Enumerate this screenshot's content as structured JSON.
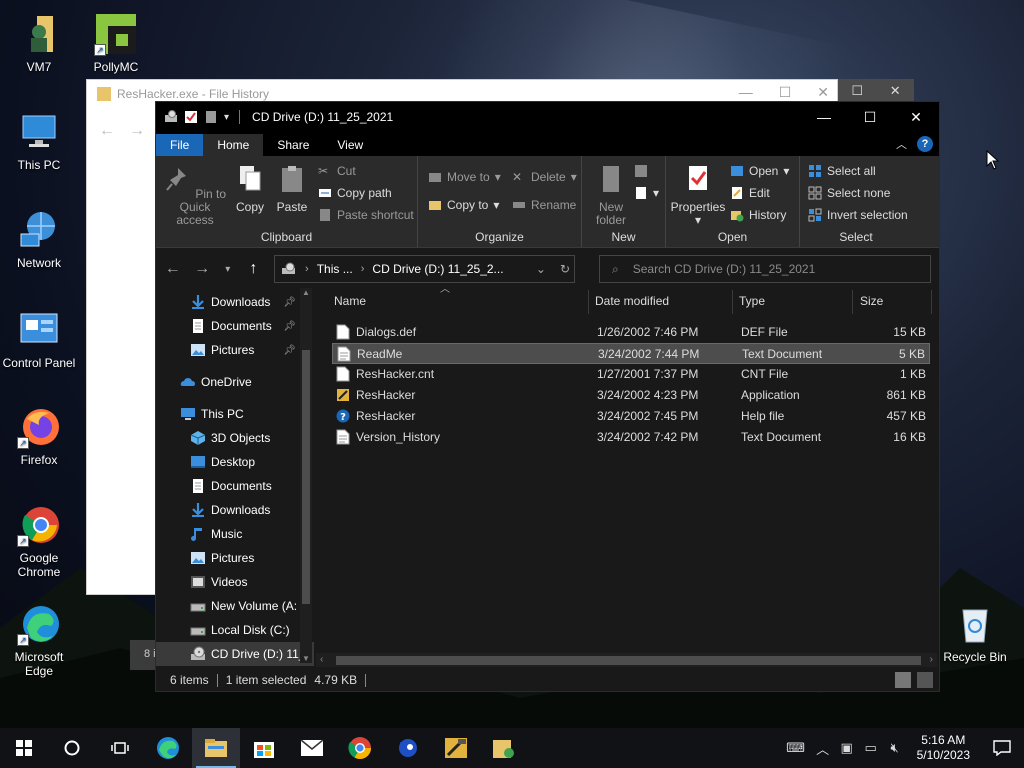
{
  "desktop": {
    "icons": [
      {
        "label": "VM7",
        "icon": "folder-user-icon"
      },
      {
        "label": "PollyMC",
        "icon": "pollymc-icon"
      },
      {
        "label": "This PC",
        "icon": "this-pc-icon"
      },
      {
        "label": "Network",
        "icon": "network-icon"
      },
      {
        "label": "Control Panel",
        "icon": "control-panel-icon"
      },
      {
        "label": "Firefox",
        "icon": "firefox-icon"
      },
      {
        "label": "Google Chrome",
        "icon": "chrome-icon"
      },
      {
        "label": "Microsoft Edge",
        "icon": "edge-icon"
      },
      {
        "label": "Recycle Bin",
        "icon": "recycle-bin-icon"
      }
    ]
  },
  "background_window": {
    "title": "ResHacker.exe - File History",
    "bottom_text": "8 i"
  },
  "explorer": {
    "title": "CD Drive (D:) 11_25_2021",
    "tabs": [
      "File",
      "Home",
      "Share",
      "View"
    ],
    "active_tab": "Home",
    "ribbon": {
      "clipboard": {
        "label": "Clipboard",
        "pin": "Pin to Quick access",
        "copy": "Copy",
        "paste": "Paste",
        "cut": "Cut",
        "copy_path": "Copy path",
        "paste_shortcut": "Paste shortcut"
      },
      "organize": {
        "label": "Organize",
        "move_to": "Move to",
        "copy_to": "Copy to",
        "delete": "Delete",
        "rename": "Rename"
      },
      "new": {
        "label": "New",
        "new_folder": "New folder"
      },
      "open": {
        "label": "Open",
        "properties": "Properties",
        "open": "Open",
        "edit": "Edit",
        "history": "History"
      },
      "select": {
        "label": "Select",
        "select_all": "Select all",
        "select_none": "Select none",
        "invert_selection": "Invert selection"
      }
    },
    "address": {
      "crumbs": [
        "This ...",
        "CD Drive (D:) 11_25_2..."
      ],
      "search_placeholder": "Search CD Drive (D:) 11_25_2021"
    },
    "nav": [
      {
        "label": "Downloads",
        "icon": "download-arrow-icon",
        "pinned": true,
        "indent": 1
      },
      {
        "label": "Documents",
        "icon": "documents-icon",
        "pinned": true,
        "indent": 1
      },
      {
        "label": "Pictures",
        "icon": "pictures-icon",
        "pinned": true,
        "indent": 1
      },
      {
        "label": "OneDrive",
        "icon": "onedrive-icon",
        "pinned": false,
        "indent": 0
      },
      {
        "label": "This PC",
        "icon": "this-pc-icon",
        "pinned": false,
        "indent": 0
      },
      {
        "label": "3D Objects",
        "icon": "3d-objects-icon",
        "pinned": false,
        "indent": 1
      },
      {
        "label": "Desktop",
        "icon": "desktop-icon",
        "pinned": false,
        "indent": 1
      },
      {
        "label": "Documents",
        "icon": "documents-icon",
        "pinned": false,
        "indent": 1
      },
      {
        "label": "Downloads",
        "icon": "download-arrow-icon",
        "pinned": false,
        "indent": 1
      },
      {
        "label": "Music",
        "icon": "music-icon",
        "pinned": false,
        "indent": 1
      },
      {
        "label": "Pictures",
        "icon": "pictures-icon",
        "pinned": false,
        "indent": 1
      },
      {
        "label": "Videos",
        "icon": "videos-icon",
        "pinned": false,
        "indent": 1
      },
      {
        "label": "New Volume (A:",
        "icon": "drive-icon",
        "pinned": false,
        "indent": 1
      },
      {
        "label": "Local Disk (C:)",
        "icon": "drive-icon",
        "pinned": false,
        "indent": 1
      },
      {
        "label": "CD Drive (D:) 11_",
        "icon": "cd-drive-icon",
        "pinned": false,
        "indent": 1,
        "selected": true
      }
    ],
    "columns": [
      "Name",
      "Date modified",
      "Type",
      "Size"
    ],
    "files": [
      {
        "name": "Dialogs.def",
        "date": "1/26/2002 7:46 PM",
        "type": "DEF File",
        "size": "15 KB",
        "icon": "file-icon"
      },
      {
        "name": "ReadMe",
        "date": "3/24/2002 7:44 PM",
        "type": "Text Document",
        "size": "5 KB",
        "icon": "text-file-icon",
        "selected": true
      },
      {
        "name": "ResHacker.cnt",
        "date": "1/27/2001 7:37 PM",
        "type": "CNT File",
        "size": "1 KB",
        "icon": "file-icon"
      },
      {
        "name": "ResHacker",
        "date": "3/24/2002 4:23 PM",
        "type": "Application",
        "size": "861 KB",
        "icon": "application-icon"
      },
      {
        "name": "ResHacker",
        "date": "3/24/2002 7:45 PM",
        "type": "Help file",
        "size": "457 KB",
        "icon": "help-file-icon"
      },
      {
        "name": "Version_History",
        "date": "3/24/2002 7:42 PM",
        "type": "Text Document",
        "size": "16 KB",
        "icon": "text-file-icon"
      }
    ],
    "status": {
      "count": "6 items",
      "selected": "1 item selected",
      "size": "4.79 KB"
    }
  },
  "taskbar": {
    "apps": [
      "start-icon",
      "search-icon",
      "task-view-icon",
      "edge-icon",
      "file-explorer-icon",
      "store-icon",
      "mail-icon",
      "chrome-icon",
      "sonic-icon",
      "reshacker-icon",
      "file-history-icon"
    ],
    "time": "5:16 AM",
    "date": "5/10/2023"
  },
  "colors": {
    "accent": "#1a67b8",
    "window_bg": "#191919",
    "ribbon_bg": "#2b2b2b",
    "selected_row": "#4d4d4d"
  }
}
